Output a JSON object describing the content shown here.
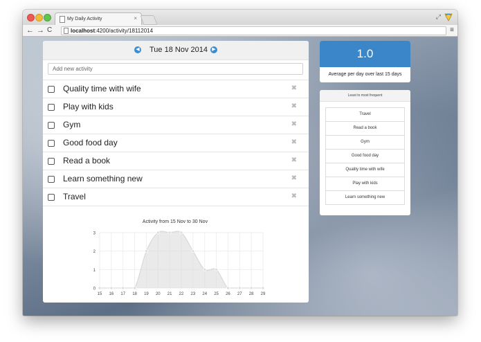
{
  "browser": {
    "tab_title": "My Daily Activity",
    "tab_close": "×",
    "url_host": "localhost",
    "url_rest": ":4200/activity/18112014"
  },
  "header": {
    "date": "Tue 18 Nov 2014",
    "prev_icon": "arrow-left",
    "next_icon": "arrow-right"
  },
  "add_input": {
    "placeholder": "Add new activity"
  },
  "activities": [
    {
      "label": "Quality time with wife",
      "checked": false
    },
    {
      "label": "Play with kids",
      "checked": false
    },
    {
      "label": "Gym",
      "checked": false
    },
    {
      "label": "Good food day",
      "checked": false
    },
    {
      "label": "Read a book",
      "checked": false
    },
    {
      "label": "Learn something new",
      "checked": false
    },
    {
      "label": "Travel",
      "checked": false
    }
  ],
  "delete_glyph": "✖",
  "score": {
    "value": "1.0",
    "label": "Average per day over last 15 days",
    "color": "#3a86c8"
  },
  "frequency": {
    "header": "Least to most frequent",
    "items": [
      "Travel",
      "Read a book",
      "Gym",
      "Good food day",
      "Quality time with wife",
      "Play with kids",
      "Learn something new"
    ]
  },
  "chart_data": {
    "type": "area",
    "title": "Activity from 15 Nov to 30 Nov",
    "x": [
      "15",
      "16",
      "17",
      "18",
      "19",
      "20",
      "21",
      "22",
      "23",
      "24",
      "25",
      "26",
      "27",
      "28",
      "29"
    ],
    "y": [
      0,
      0,
      0,
      0,
      2,
      3,
      3,
      3,
      2,
      1,
      1,
      0,
      0,
      0,
      0
    ],
    "yticks": [
      0,
      1,
      2,
      3
    ],
    "ylim": [
      0,
      3
    ],
    "grid": true
  }
}
